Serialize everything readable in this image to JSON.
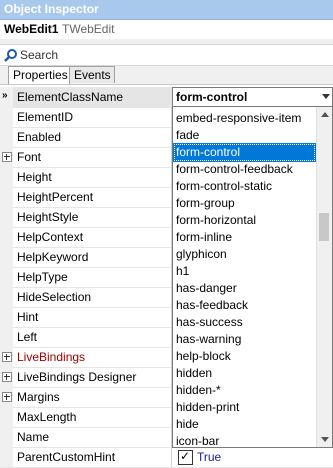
{
  "window": {
    "title": "Object Inspector"
  },
  "object": {
    "name": "WebEdit1",
    "type": "TWebEdit"
  },
  "search": {
    "placeholder": "Search",
    "value": ""
  },
  "tabs": [
    {
      "label": "Properties",
      "active": true
    },
    {
      "label": "Events",
      "active": false
    }
  ],
  "selected_property": {
    "name": "ElementClassName",
    "value": "form-control",
    "arrow": "»"
  },
  "properties": [
    {
      "name": "ElementID",
      "expandable": false,
      "style": "normal"
    },
    {
      "name": "Enabled",
      "expandable": false,
      "style": "normal"
    },
    {
      "name": "Font",
      "expandable": true,
      "style": "normal"
    },
    {
      "name": "Height",
      "expandable": false,
      "style": "normal"
    },
    {
      "name": "HeightPercent",
      "expandable": false,
      "style": "normal"
    },
    {
      "name": "HeightStyle",
      "expandable": false,
      "style": "normal"
    },
    {
      "name": "HelpContext",
      "expandable": false,
      "style": "normal"
    },
    {
      "name": "HelpKeyword",
      "expandable": false,
      "style": "normal"
    },
    {
      "name": "HelpType",
      "expandable": false,
      "style": "normal"
    },
    {
      "name": "HideSelection",
      "expandable": false,
      "style": "normal"
    },
    {
      "name": "Hint",
      "expandable": false,
      "style": "normal"
    },
    {
      "name": "Left",
      "expandable": false,
      "style": "normal"
    },
    {
      "name": "LiveBindings",
      "expandable": true,
      "style": "red"
    },
    {
      "name": "LiveBindings Designer",
      "expandable": true,
      "style": "normal"
    },
    {
      "name": "Margins",
      "expandable": true,
      "style": "normal"
    },
    {
      "name": "MaxLength",
      "expandable": false,
      "style": "normal"
    },
    {
      "name": "Name",
      "expandable": false,
      "style": "normal"
    },
    {
      "name": "ParentCustomHint",
      "expandable": false,
      "style": "normal"
    }
  ],
  "parent_custom_hint": {
    "checked": true,
    "label": "True"
  },
  "dropdown": {
    "selected_index": 2,
    "items": [
      "embed-responsive-item",
      "fade",
      "form-control",
      "form-control-feedback",
      "form-control-static",
      "form-group",
      "form-horizontal",
      "form-inline",
      "glyphicon",
      "h1",
      "has-danger",
      "has-feedback",
      "has-success",
      "has-warning",
      "help-block",
      "hidden",
      "hidden-*",
      "hidden-print",
      "hide",
      "icon-bar"
    ]
  },
  "colors": {
    "title_bg": "#a9c9ec",
    "selection": "#0078d7",
    "red_text": "#a00000"
  }
}
